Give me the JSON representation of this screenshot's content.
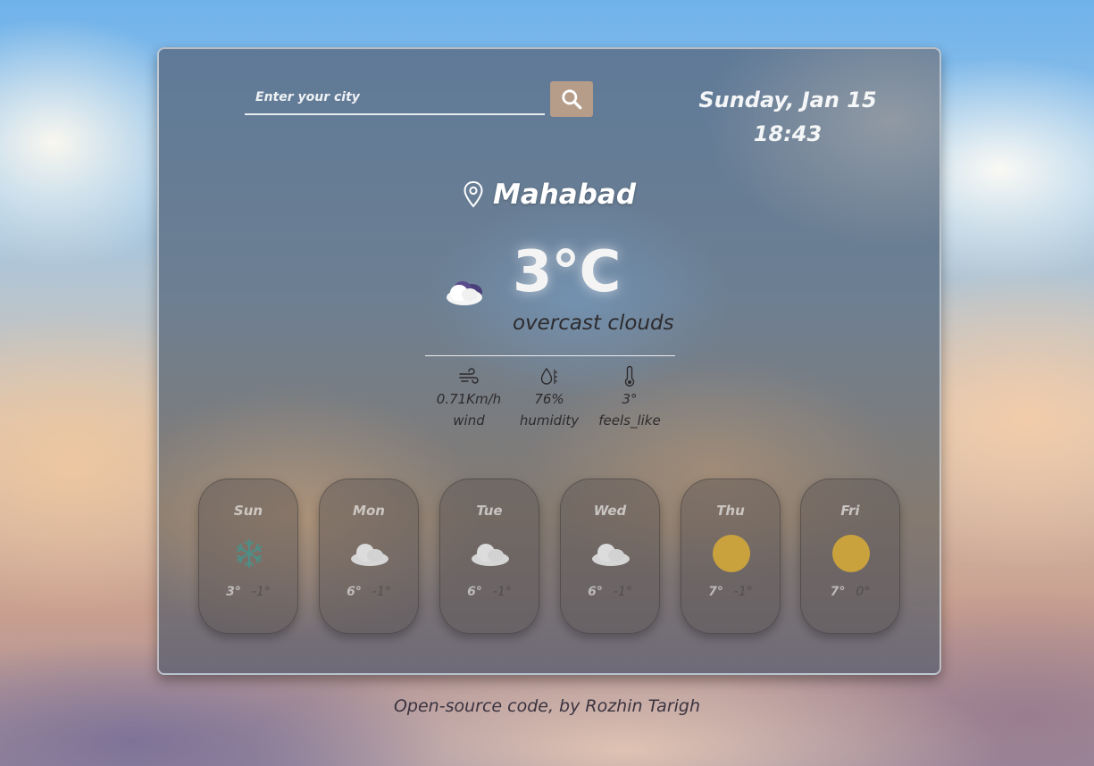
{
  "search": {
    "placeholder": "Enter your city",
    "button_icon": "search-icon"
  },
  "datetime": {
    "date": "Sunday, Jan 15",
    "time": "18:43"
  },
  "location": {
    "icon": "map-pin-icon",
    "city": "Mahabad"
  },
  "current": {
    "icon": "cloud-icon",
    "temperature": "3°C",
    "description": "overcast clouds"
  },
  "details": [
    {
      "icon": "wind-icon",
      "value": "0.71Km/h",
      "label": "wind"
    },
    {
      "icon": "humidity-icon",
      "value": "76%",
      "label": "humidity"
    },
    {
      "icon": "thermometer-icon",
      "value": "3°",
      "label": "feels_like"
    }
  ],
  "forecast": [
    {
      "day": "Sun",
      "icon": "snowflake-icon",
      "max": "3°",
      "min": "-1°"
    },
    {
      "day": "Mon",
      "icon": "cloud-icon",
      "max": "6°",
      "min": "-1°"
    },
    {
      "day": "Tue",
      "icon": "cloud-icon",
      "max": "6°",
      "min": "-1°"
    },
    {
      "day": "Wed",
      "icon": "cloud-icon",
      "max": "6°",
      "min": "-1°"
    },
    {
      "day": "Thu",
      "icon": "sun-icon",
      "max": "7°",
      "min": "-1°"
    },
    {
      "day": "Fri",
      "icon": "sun-icon",
      "max": "7°",
      "min": "0°"
    }
  ],
  "footer": {
    "text": "Open-source code, by Rozhin Tarigh"
  },
  "colors": {
    "search_button": "#b59d8a",
    "sun": "#c9a23e",
    "snowflake": "#4f8e86",
    "cloud": "#d9d9d9"
  }
}
